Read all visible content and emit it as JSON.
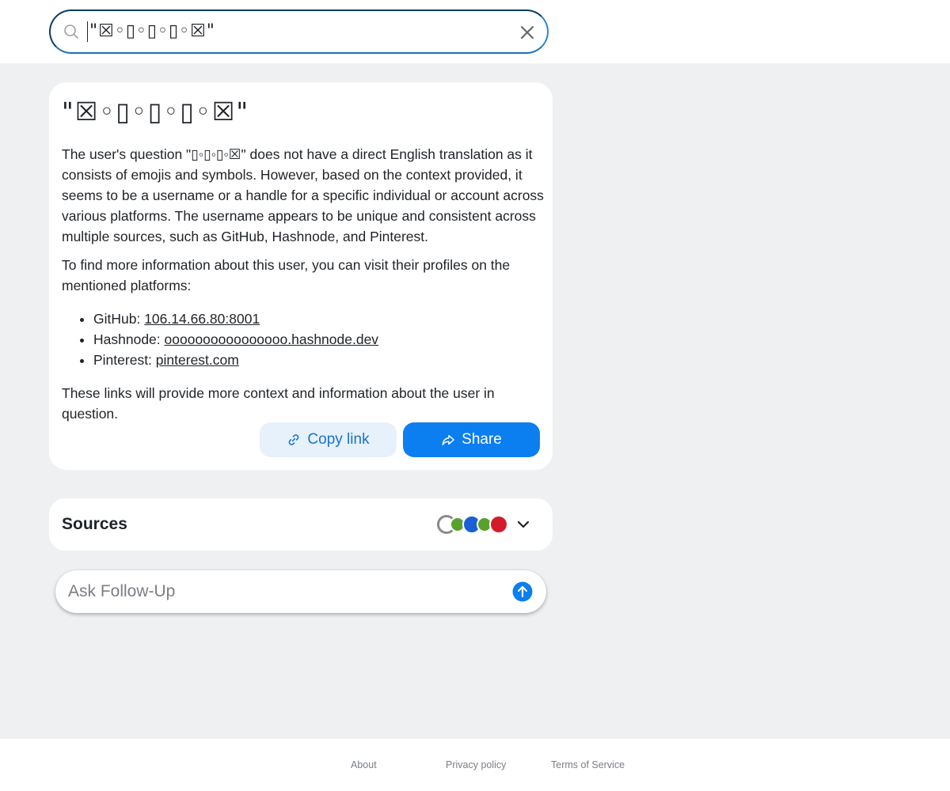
{
  "search": {
    "value": "\"☒◦▯◦▯◦▯◦☒\""
  },
  "answer": {
    "title": "\"☒◦▯◦▯◦▯◦☒\"",
    "paragraph1": "The user's question \"▯◦▯◦▯◦☒\" does not have a direct English translation as it consists of emojis and symbols. However, based on the context provided, it seems to be a username or a handle for a specific individual or account across various platforms. The username appears to be unique and consistent across multiple sources, such as GitHub, Hashnode, and Pinterest.",
    "paragraph2": "To find more information about this user, you can visit their profiles on the mentioned platforms:",
    "links": [
      {
        "label": "GitHub: ",
        "link": "106.14.66.80:8001"
      },
      {
        "label": "Hashnode: ",
        "link": "oooooooooooooooo.hashnode.dev"
      },
      {
        "label": "Pinterest: ",
        "link": "pinterest.com"
      }
    ],
    "paragraph3": "These links will provide more context and information about the user in question.",
    "copy_label": "Copy link",
    "share_label": "Share"
  },
  "sources": {
    "title": "Sources",
    "favicon_colors": [
      "#8a8a8a",
      "#5aa02c",
      "#1a5fd6",
      "#5aa02c",
      "#d21c2c"
    ]
  },
  "followup": {
    "placeholder": "Ask Follow-Up"
  },
  "footer": {
    "about": "About",
    "privacy": "Privacy policy",
    "terms": "Terms of Service"
  },
  "colors": {
    "accent": "#0b7ef0",
    "accent_light": "#e6f1fb",
    "background": "#eef0f2"
  }
}
